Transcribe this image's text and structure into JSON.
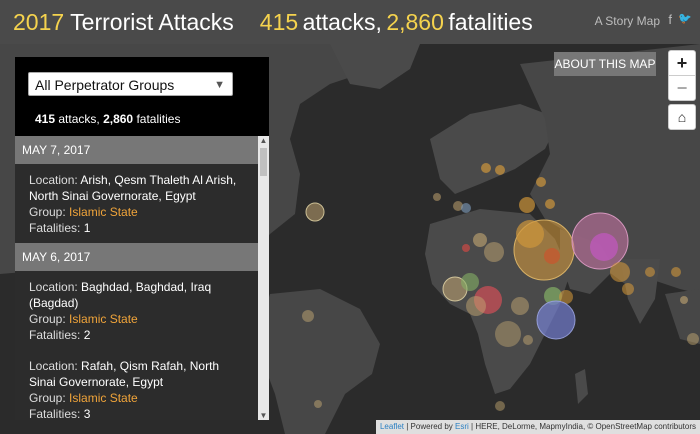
{
  "header": {
    "year": "2017",
    "title": "Terrorist Attacks",
    "attacks_num": "415",
    "attacks_txt": "attacks,",
    "fatalities_num": "2,860",
    "fatalities_txt": "fatalities",
    "storymap": "A Story Map",
    "facebook_glyph": "f",
    "twitter_glyph": "🐦"
  },
  "panel": {
    "selected_group": "All Perpetrator Groups",
    "summary": {
      "attacks_num": "415",
      "attacks_txt": "attacks,",
      "fatalities_num": "2,860",
      "fatalities_txt": "fatalities"
    },
    "sections": [
      {
        "date": "MAY 7, 2017",
        "entries": [
          {
            "location_label": "Location:",
            "location": "Arish, Qesm Thaleth Al Arish, North Sinai Governorate, Egypt",
            "group_label": "Group:",
            "group": "Islamic State",
            "fatalities_label": "Fatalities:",
            "fatalities": "1"
          }
        ]
      },
      {
        "date": "MAY 6, 2017",
        "entries": [
          {
            "location_label": "Location:",
            "location": "Baghdad, Baghdad, Iraq (Bagdad)",
            "group_label": "Group:",
            "group": "Islamic State",
            "fatalities_label": "Fatalities:",
            "fatalities": "2"
          },
          {
            "location_label": "Location:",
            "location": "Rafah, Qism Rafah, North Sinai Governorate, Egypt",
            "group_label": "Group:",
            "group": "Islamic State",
            "fatalities_label": "Fatalities:",
            "fatalities": "3"
          }
        ]
      }
    ]
  },
  "buttons": {
    "about": "ABOUT THIS MAP",
    "zoom_in": "+",
    "zoom_out": "−",
    "home": "⌂"
  },
  "attribution": {
    "leaflet": "Leaflet",
    "powered": "| Powered by",
    "esri": "Esri",
    "rest": "| HERE, DeLorme, MapmyIndia, © OpenStreetMap contributors"
  },
  "colors": {
    "accent_yellow": "#f5d34e",
    "group_orange": "#f0a43a",
    "land": "#4a4a4a",
    "ocean": "#2b2b2b"
  }
}
